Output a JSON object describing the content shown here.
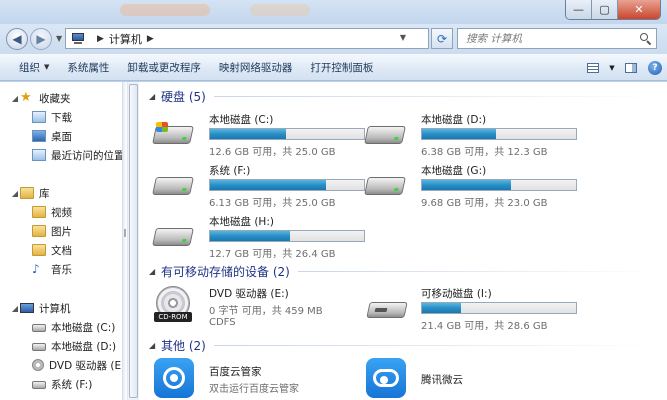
{
  "window": {
    "controls": {
      "minimize": "—",
      "maximize": "▢",
      "close": "✕"
    }
  },
  "address": {
    "location": "计算机",
    "icon": "computer-icon",
    "search_placeholder": "搜索 计算机"
  },
  "toolbar": {
    "items": [
      "组织",
      "系统属性",
      "卸载或更改程序",
      "映射网络驱动器",
      "打开控制面板"
    ]
  },
  "sidebar": {
    "favorites": {
      "label": "收藏夹",
      "items": [
        "下载",
        "桌面",
        "最近访问的位置"
      ]
    },
    "libraries": {
      "label": "库",
      "items": [
        "视频",
        "图片",
        "文档",
        "音乐"
      ]
    },
    "computer": {
      "label": "计算机",
      "items": [
        "本地磁盘 (C:)",
        "本地磁盘 (D:)",
        "DVD 驱动器 (E:)",
        "系统 (F:)"
      ]
    }
  },
  "content": {
    "groups": {
      "hdd": "硬盘 (5)",
      "removable": "有可移动存储的设备 (2)",
      "other": "其他 (2)"
    },
    "drives": [
      {
        "name": "本地磁盘 (C:)",
        "info": "12.6 GB 可用，共 25.0 GB",
        "used_fraction": 0.496
      },
      {
        "name": "本地磁盘 (D:)",
        "info": "6.38 GB 可用，共 12.3 GB",
        "used_fraction": 0.481
      },
      {
        "name": "系统 (F:)",
        "info": "6.13 GB 可用，共 25.0 GB",
        "used_fraction": 0.755
      },
      {
        "name": "本地磁盘 (G:)",
        "info": "9.68 GB 可用，共 23.0 GB",
        "used_fraction": 0.579
      },
      {
        "name": "本地磁盘 (H:)",
        "info": "12.7 GB 可用，共 26.4 GB",
        "used_fraction": 0.519
      }
    ],
    "dvd": {
      "name": "DVD 驱动器 (E:)",
      "info": "0 字节 可用，共 459 MB",
      "fs": "CDFS",
      "badge": "CD-ROM"
    },
    "usb": {
      "name": "可移动磁盘 (I:)",
      "info": "21.4 GB 可用，共 28.6 GB",
      "used_fraction": 0.252
    },
    "apps": [
      {
        "name": "百度云管家",
        "desc": "双击运行百度云管家"
      },
      {
        "name": "腾讯微云",
        "desc": ""
      }
    ]
  },
  "colors": {
    "bar_fill": "#2a8fc6",
    "group_header": "#1e3287"
  }
}
